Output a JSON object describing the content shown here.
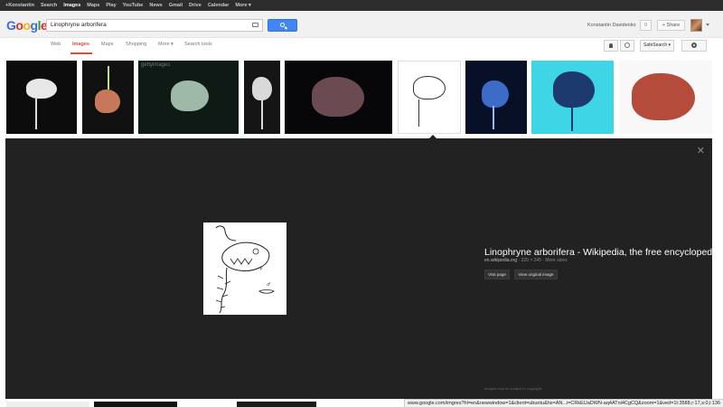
{
  "topbar": {
    "items": [
      "+Konstantin",
      "Search",
      "Images",
      "Maps",
      "Play",
      "YouTube",
      "News",
      "Gmail",
      "Drive",
      "Calendar",
      "More ▾"
    ],
    "active": "Images"
  },
  "logo": {
    "letters": [
      "G",
      "o",
      "o",
      "g",
      "l",
      "e"
    ]
  },
  "search": {
    "value": "Linophryne arborifera"
  },
  "account": {
    "name": "Konstantin Davidenko",
    "notifications": "0",
    "share_label": "+ Share"
  },
  "tabs": [
    {
      "label": "Web"
    },
    {
      "label": "Images"
    },
    {
      "label": "Maps"
    },
    {
      "label": "Shopping"
    },
    {
      "label": "More ▾"
    },
    {
      "label": "Search tools"
    }
  ],
  "tools": {
    "safesearch_label": "SafeSearch ▾"
  },
  "thumbnails": [
    {
      "bg": "#0c0c0c",
      "fish": "#e8e8e8"
    },
    {
      "bg": "#111",
      "fish": "#c8785a"
    },
    {
      "bg": "#0f1a16",
      "fish": "#9fb9a8",
      "watermark": "gettyimages"
    },
    {
      "bg": "#151515",
      "fish": "#d9d9d9"
    },
    {
      "bg": "#07070a",
      "fish": "#6b4a52"
    },
    {
      "bg": "#ffffff",
      "fish": "#f2f2f2"
    },
    {
      "bg": "#071026",
      "fish": "#3c6cc8"
    },
    {
      "bg": "#3ed6e6",
      "fish": "#1c3a6e"
    },
    {
      "bg": "#f8f8f8",
      "fish": "#b54b3a"
    }
  ],
  "detail": {
    "title": "Linophryne arborifera - Wikipedia, the free encyclopedia",
    "source": "en.wikipedia.org",
    "size": " · 220 × 245 · More sizes",
    "visit_label": "Visit page",
    "view_label": "View original image",
    "copyright": "Images may be subject to copyright.",
    "close": "✕"
  },
  "status_url": "www.google.com/imgres?hl=en&newwindow=1&client=ubuntu&hs=AN...i=CRkEUaDWN-aq4ATni4CgCQ&zoom=1&ved=1t:3588,r:17,s:0,i:136"
}
